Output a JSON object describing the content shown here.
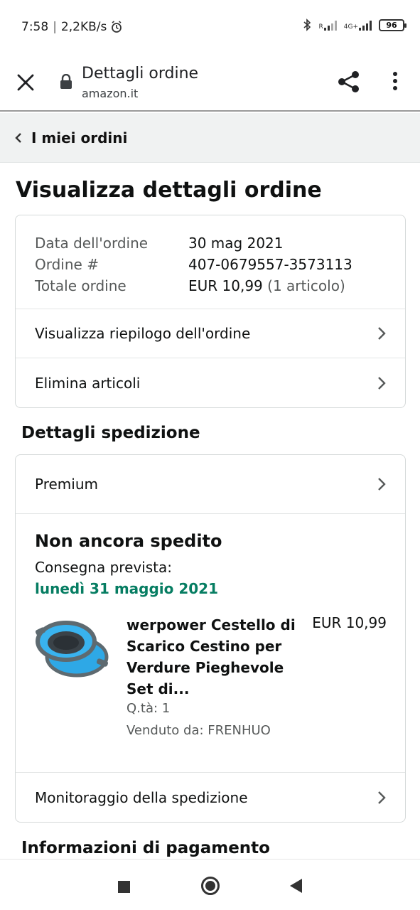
{
  "status_bar": {
    "time": "7:58",
    "network_speed": "2,2KB/s",
    "net_r": "R",
    "net_4g": "4G+",
    "battery": "96"
  },
  "browser": {
    "title": "Dettagli ordine",
    "url": "amazon.it"
  },
  "breadcrumb": {
    "label": "I miei ordini"
  },
  "page_title": "Visualizza dettagli ordine",
  "order": {
    "date_label": "Data dell'ordine",
    "date_value": "30 mag 2021",
    "number_label": "Ordine #",
    "number_value": "407-0679557-3573113",
    "total_label": "Totale ordine",
    "total_value": "EUR 10,99",
    "total_items": "(1 articolo)",
    "summary_link": "Visualizza riepilogo dell'ordine",
    "delete_link": "Elimina articoli"
  },
  "shipping": {
    "section_title": "Dettagli spedizione",
    "method": "Premium",
    "status": "Non ancora spedito",
    "delivery_label": "Consegna prevista:",
    "delivery_date": "lunedì 31 maggio 2021",
    "product": {
      "name": "werpower Cestello di Scarico Cestino per Verdure Pieghevole Set di...",
      "price": "EUR 10,99",
      "qty": "Q.tà: 1",
      "seller": "Venduto da: FRENHUO"
    },
    "tracking_link": "Monitoraggio della spedizione"
  },
  "payment": {
    "section_title": "Informazioni di pagamento"
  },
  "colors": {
    "delivery_green": "#067d62",
    "crumb_bg": "#f0f2f2",
    "product_blue": "#2ea8e6"
  },
  "icons": [
    "close-icon",
    "lock-icon",
    "share-icon",
    "more-icon",
    "chevron-left-icon",
    "chevron-right-icon",
    "bluetooth-icon",
    "alarm-icon"
  ]
}
